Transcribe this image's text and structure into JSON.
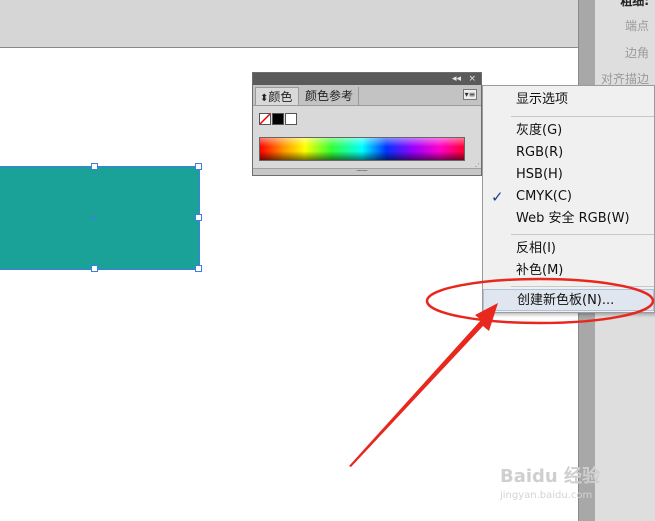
{
  "right_panel": {
    "labels": [
      "粗细:",
      "端点",
      "边角",
      "对齐描边"
    ]
  },
  "color_panel": {
    "collapse_icon": "◂◂",
    "close_icon": "×",
    "tabs": [
      "颜色",
      "颜色参考"
    ],
    "active_tab_prefix": "⬍",
    "menu_icon": "▾≡",
    "swatches": {
      "none": "none-swatch",
      "black": "#000000",
      "white": "#ffffff"
    },
    "grip": "·········",
    "resize": "⋰"
  },
  "menu": {
    "items": [
      {
        "label": "显示选项"
      },
      {
        "label": "灰度(G)"
      },
      {
        "label": "RGB(R)"
      },
      {
        "label": "HSB(H)"
      },
      {
        "label": "CMYK(C)",
        "checked": true
      },
      {
        "label": "Web 安全 RGB(W)"
      },
      {
        "label": "反相(I)"
      },
      {
        "label": "补色(M)"
      },
      {
        "label": "创建新色板(N)..."
      }
    ],
    "check_mark": "✓"
  },
  "object": {
    "fill_color": "#1aa198"
  },
  "annotation": {
    "color": "#e8281f"
  },
  "watermark": {
    "main": "Baidu 经验",
    "sub": "jingyan.baidu.com"
  }
}
